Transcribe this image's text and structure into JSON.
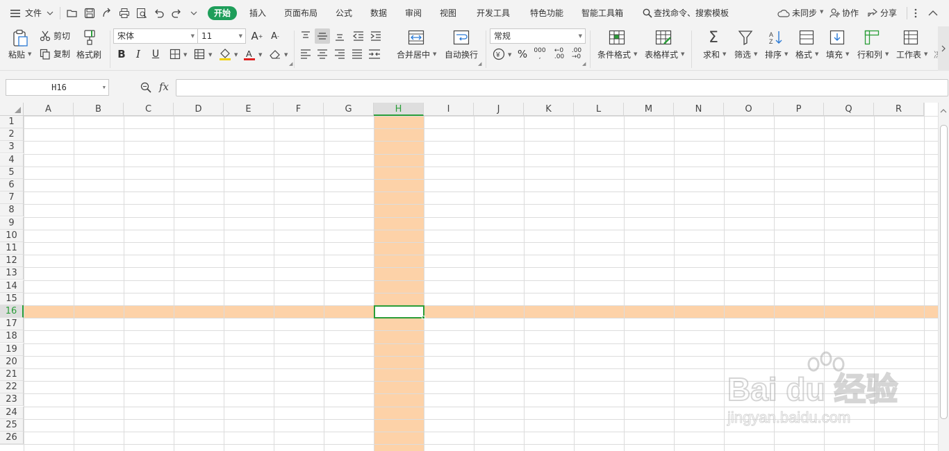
{
  "menubar": {
    "file_label": "文件",
    "tabs": [
      {
        "label": "开始",
        "active": true
      },
      {
        "label": "插入"
      },
      {
        "label": "页面布局"
      },
      {
        "label": "公式"
      },
      {
        "label": "数据"
      },
      {
        "label": "审阅"
      },
      {
        "label": "视图"
      },
      {
        "label": "开发工具"
      },
      {
        "label": "特色功能"
      },
      {
        "label": "智能工具箱"
      }
    ],
    "search_label": "查找命令、搜索模板",
    "sync_label": "未同步",
    "collab_label": "协作",
    "share_label": "分享"
  },
  "ribbon": {
    "paste": "粘贴",
    "cut": "剪切",
    "copy": "复制",
    "format_painter": "格式刷",
    "font_name": "宋体",
    "font_size": "11",
    "bold": "B",
    "italic": "I",
    "underline": "U",
    "merge_center": "合并居中",
    "wrap_text": "自动换行",
    "number_format": "常规",
    "conditional_format": "条件格式",
    "table_style": "表格样式",
    "sum": "求和",
    "filter": "筛选",
    "sort": "排序",
    "format": "格式",
    "fill": "填充",
    "row_col": "行和列",
    "worksheet": "工作表",
    "more": "冻"
  },
  "formula_bar": {
    "name_box": "H16",
    "fx": "fx",
    "value": ""
  },
  "sheet": {
    "columns": [
      "A",
      "B",
      "C",
      "D",
      "E",
      "F",
      "G",
      "H",
      "I",
      "J",
      "K",
      "L",
      "M",
      "N",
      "O",
      "P",
      "Q",
      "R"
    ],
    "rows": [
      "1",
      "2",
      "3",
      "4",
      "5",
      "6",
      "7",
      "8",
      "9",
      "10",
      "11",
      "12",
      "13",
      "14",
      "15",
      "16",
      "17",
      "18",
      "19",
      "20",
      "21",
      "22",
      "23",
      "24",
      "25",
      "26"
    ],
    "active_column": "H",
    "active_row": "16",
    "highlight_color": "#fdd2a8",
    "accent_color": "#2a9d38"
  },
  "watermark": {
    "brand": "Bai du 经验",
    "url": "jingyan.baidu.com"
  }
}
